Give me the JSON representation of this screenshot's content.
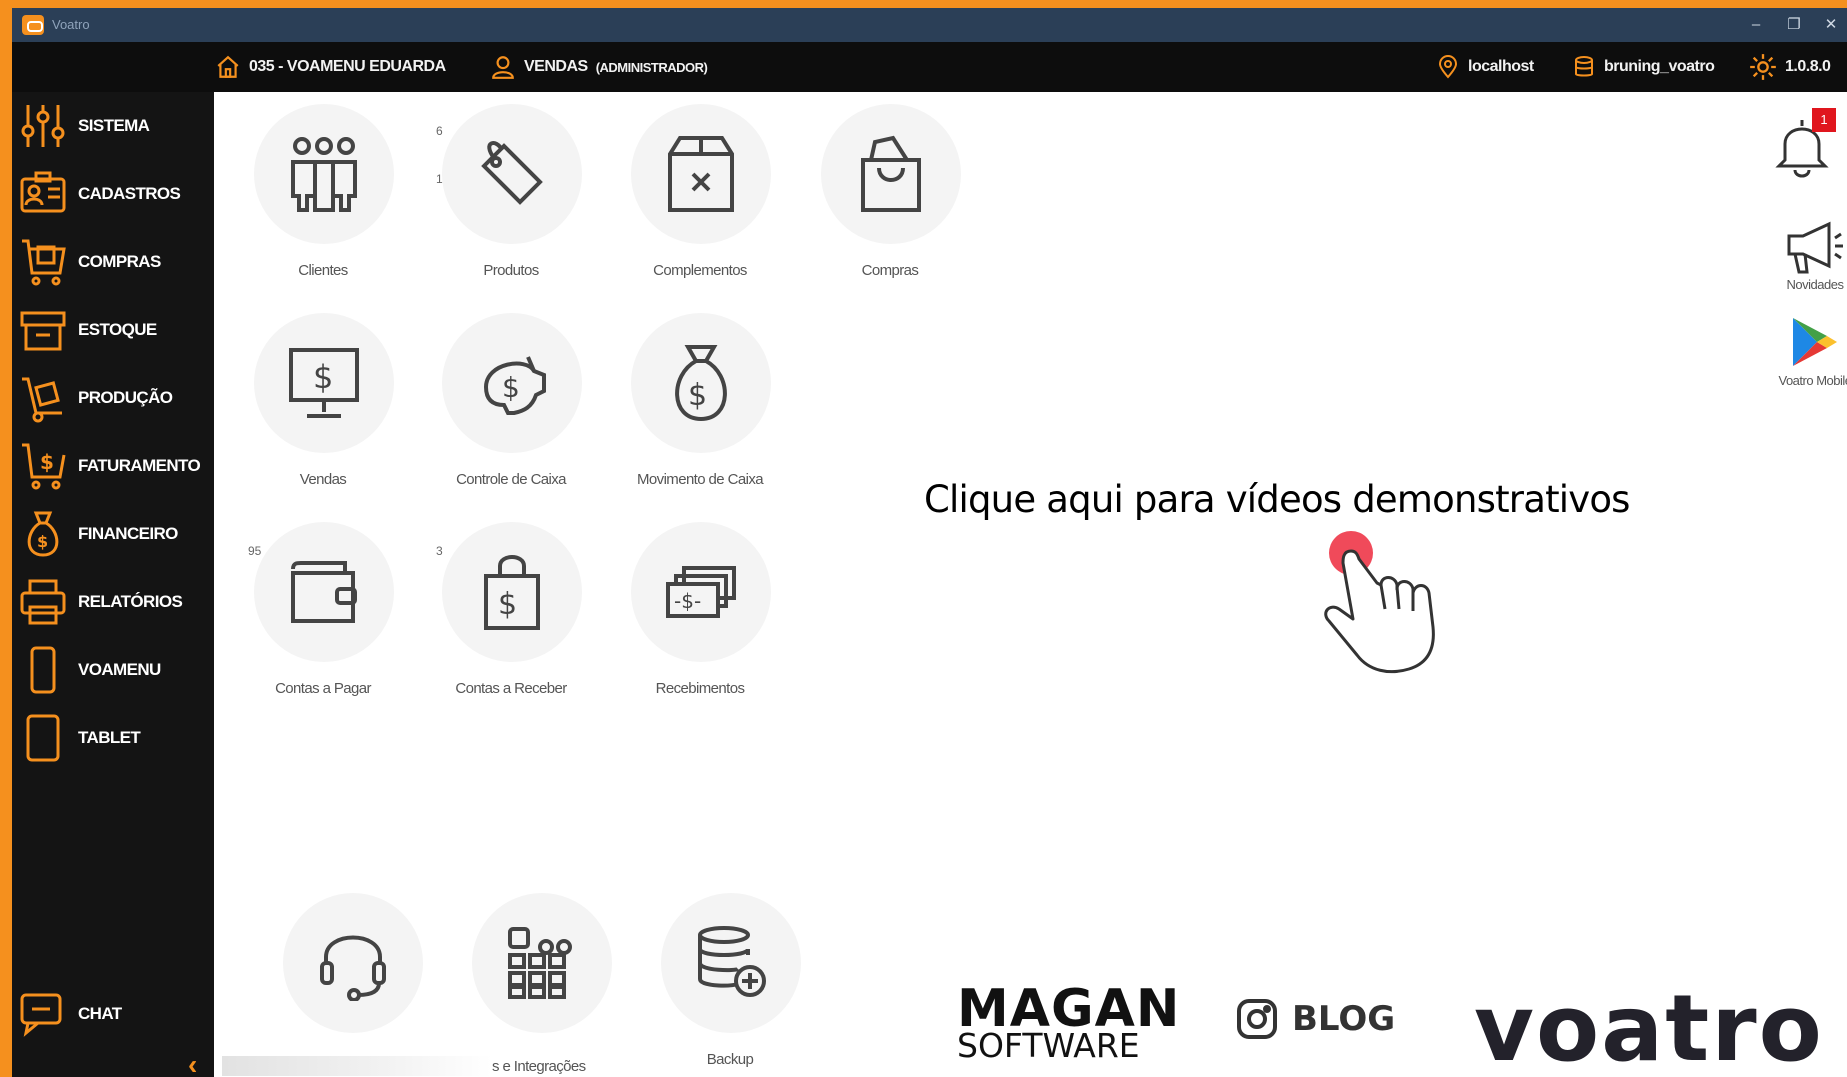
{
  "window": {
    "title": "Voatro"
  },
  "header": {
    "location": "035 - VOAMENU EDUARDA",
    "user_role": "VENDAS",
    "user_role_sub": "(ADMINISTRADOR)",
    "server": "localhost",
    "database": "bruning_voatro",
    "version": "1.0.8.0"
  },
  "sidebar": {
    "items": [
      {
        "label": "SISTEMA",
        "icon": "sliders-icon"
      },
      {
        "label": "CADASTROS",
        "icon": "id-card-icon"
      },
      {
        "label": "COMPRAS",
        "icon": "shopping-cart-icon"
      },
      {
        "label": "ESTOQUE",
        "icon": "box-icon"
      },
      {
        "label": "PRODUÇÃO",
        "icon": "hand-truck-icon"
      },
      {
        "label": "FATURAMENTO",
        "icon": "cart-dollar-icon"
      },
      {
        "label": "FINANCEIRO",
        "icon": "money-bag-icon"
      },
      {
        "label": "RELATÓRIOS",
        "icon": "printer-icon"
      },
      {
        "label": "VOAMENU",
        "icon": "smartphone-icon"
      },
      {
        "label": "TABLET",
        "icon": "tablet-icon"
      }
    ],
    "chat": {
      "label": "CHAT",
      "icon": "chat-icon"
    },
    "collapse": "‹"
  },
  "tiles": {
    "clientes": {
      "label": "Clientes"
    },
    "produtos": {
      "label": "Produtos",
      "badge_top": "6",
      "badge_mid": "1"
    },
    "complementos": {
      "label": "Complementos"
    },
    "compras": {
      "label": "Compras"
    },
    "vendas": {
      "label": "Vendas"
    },
    "controle_caixa": {
      "label": "Controle de Caixa"
    },
    "movimento_caixa": {
      "label": "Movimento de Caixa"
    },
    "contas_pagar": {
      "label": "Contas a Pagar",
      "badge": "95"
    },
    "contas_receber": {
      "label": "Contas a Receber",
      "badge": "3"
    },
    "recebimentos": {
      "label": "Recebimentos"
    },
    "suporte": {
      "label": ""
    },
    "integracoes": {
      "label": "s e Integrações"
    },
    "backup": {
      "label": "Backup"
    }
  },
  "rail": {
    "notifications_count": "1",
    "novidades": "Novidades",
    "mobile": "Voatro Mobile"
  },
  "overlay": {
    "text": "Clique aqui para vídeos demonstrativos"
  },
  "brands": {
    "magan_top": "MAGAN",
    "magan_bottom": "SOFTWARE",
    "blog": "BLOG",
    "voatro": "voatro"
  },
  "colors": {
    "accent": "#f5901e",
    "sidebar": "#141414",
    "header": "#0d0d0d",
    "titlebar": "#2b3f57"
  }
}
